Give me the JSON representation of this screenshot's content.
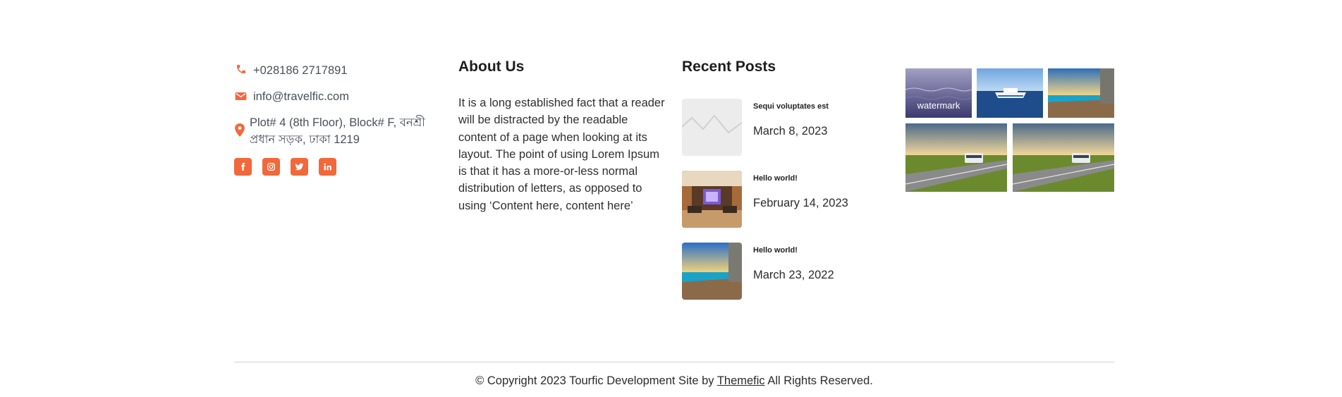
{
  "contact": {
    "phone": "+028186 2717891",
    "email": "info@travelfic.com",
    "address": "Plot# 4 (8th Floor), Block# F, বনশ্রী প্রধান সড়ক, ঢাকা 1219",
    "icons": [
      "phone-icon",
      "envelope-icon",
      "map-pin-icon"
    ]
  },
  "social": [
    "facebook-icon",
    "instagram-icon",
    "twitter-icon",
    "linkedin-icon"
  ],
  "about": {
    "title": "About Us",
    "text": "It is a long established fact that a reader will be distracted by the readable content of a page when looking at its layout. The point of using Lorem Ipsum is that it has a more-or-less normal distribution of letters, as opposed to using ‘Content here, content here’"
  },
  "recent": {
    "title": "Recent Posts",
    "posts": [
      {
        "title": "Sequi voluptates est",
        "date": "March 8, 2023"
      },
      {
        "title": "Hello world!",
        "date": "February 14, 2023"
      },
      {
        "title": "Hello world!",
        "date": "March 23, 2022"
      }
    ]
  },
  "gallery": {
    "watermark": "watermark"
  },
  "footer": {
    "prefix": "© Copyright 2023 Tourfic Development Site by",
    "link": "Themefic",
    "suffix": "All Rights Reserved."
  },
  "colors": {
    "accent": "#f2683a",
    "rule": "#cfcfcf",
    "text": "#2b2b2b"
  }
}
